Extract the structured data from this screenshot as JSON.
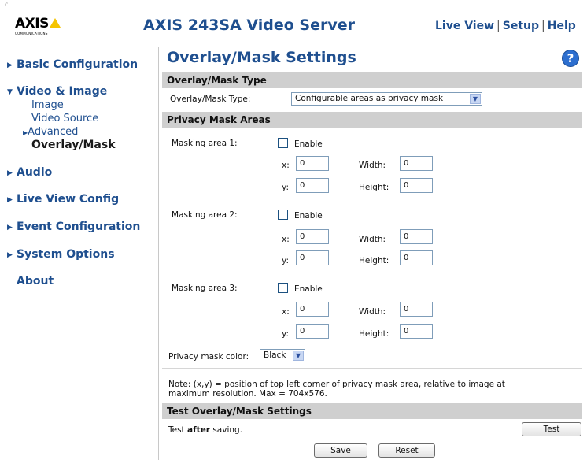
{
  "brand": {
    "name": "AXIS",
    "sub": "COMMUNICATIONS"
  },
  "header": {
    "title": "AXIS 243SA Video Server",
    "nav": [
      "Live View",
      "Setup",
      "Help"
    ],
    "corner_mark": "c"
  },
  "sidebar": {
    "items": [
      {
        "label": "Basic Configuration"
      },
      {
        "label": "Video & Image"
      },
      {
        "label": "Audio"
      },
      {
        "label": "Live View Config"
      },
      {
        "label": "Event Configuration"
      },
      {
        "label": "System Options"
      },
      {
        "label": "About"
      }
    ],
    "video_sub": [
      "Image",
      "Video Source",
      "Advanced",
      "Overlay/Mask"
    ]
  },
  "page": {
    "title": "Overlay/Mask Settings",
    "help_icon": "?",
    "section_type": "Overlay/Mask Type",
    "type_label": "Overlay/Mask Type:",
    "type_value": "Configurable areas as privacy mask",
    "section_areas": "Privacy Mask Areas",
    "areas": [
      {
        "label": "Masking area 1:",
        "enable": "Enable",
        "x_label": "x:",
        "x": "0",
        "y_label": "y:",
        "y": "0",
        "w_label": "Width:",
        "w": "0",
        "h_label": "Height:",
        "h": "0"
      },
      {
        "label": "Masking area 2:",
        "enable": "Enable",
        "x_label": "x:",
        "x": "0",
        "y_label": "y:",
        "y": "0",
        "w_label": "Width:",
        "w": "0",
        "h_label": "Height:",
        "h": "0"
      },
      {
        "label": "Masking area 3:",
        "enable": "Enable",
        "x_label": "x:",
        "x": "0",
        "y_label": "y:",
        "y": "0",
        "w_label": "Width:",
        "w": "0",
        "h_label": "Height:",
        "h": "0"
      }
    ],
    "color_label": "Privacy mask color:",
    "color_value": "Black",
    "note_line1": "Note: (x,y) = position of top left corner of privacy mask area, relative to image at",
    "note_line2": "maximum resolution. Max = 704x576.",
    "section_test": "Test Overlay/Mask Settings",
    "test_before": "Test ",
    "test_bold": "after",
    "test_after": " saving.",
    "test_button": "Test",
    "save_button": "Save",
    "reset_button": "Reset"
  },
  "colors": {
    "link": "#1f4f8f",
    "bar": "#cfcfcf"
  }
}
